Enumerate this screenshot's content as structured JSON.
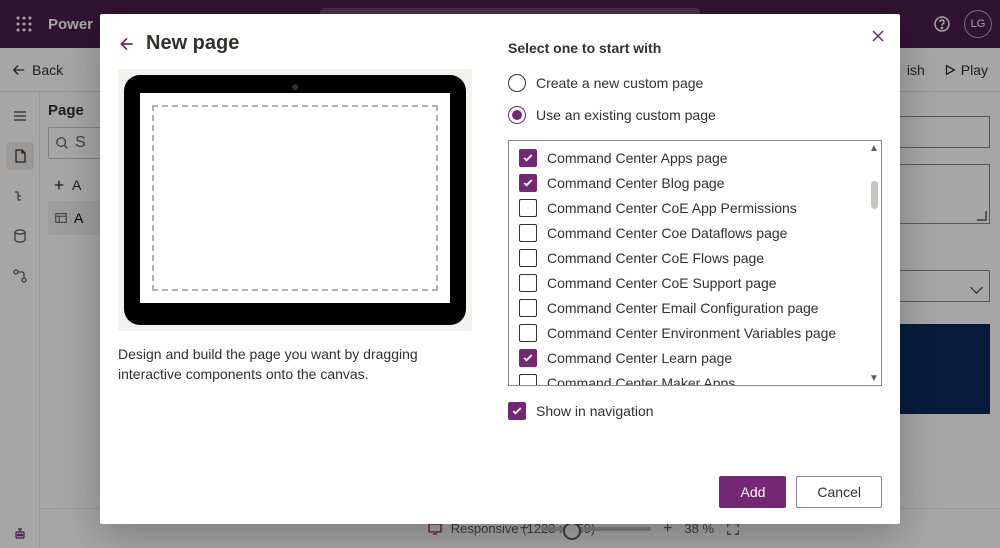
{
  "topbar": {
    "brand": "Power",
    "avatar": "LG"
  },
  "cmdbar": {
    "back": "Back",
    "publish": "ish",
    "play": "Play"
  },
  "panel": {
    "title": "Page",
    "search_placeholder": "S",
    "add": "A",
    "row": "A"
  },
  "status": {
    "responsive": "Responsive (1223 x 759)",
    "zoom": "38 %"
  },
  "modal": {
    "title": "New page",
    "description": "Design and build the page you want by dragging interactive components onto the canvas.",
    "section_title": "Select one to start with",
    "radio_create": "Create a new custom page",
    "radio_existing": "Use an existing custom page",
    "options": [
      {
        "label": "Command Center Apps page",
        "checked": true
      },
      {
        "label": "Command Center Blog page",
        "checked": true
      },
      {
        "label": "Command Center CoE App Permissions",
        "checked": false
      },
      {
        "label": "Command Center Coe Dataflows page",
        "checked": false
      },
      {
        "label": "Command Center CoE Flows page",
        "checked": false
      },
      {
        "label": "Command Center CoE Support page",
        "checked": false
      },
      {
        "label": "Command Center Email Configuration page",
        "checked": false
      },
      {
        "label": "Command Center Environment Variables page",
        "checked": false
      },
      {
        "label": "Command Center Learn page",
        "checked": true
      },
      {
        "label": "Command Center Maker Apps",
        "checked": false
      }
    ],
    "show_nav": "Show in navigation",
    "add_btn": "Add",
    "cancel_btn": "Cancel"
  }
}
